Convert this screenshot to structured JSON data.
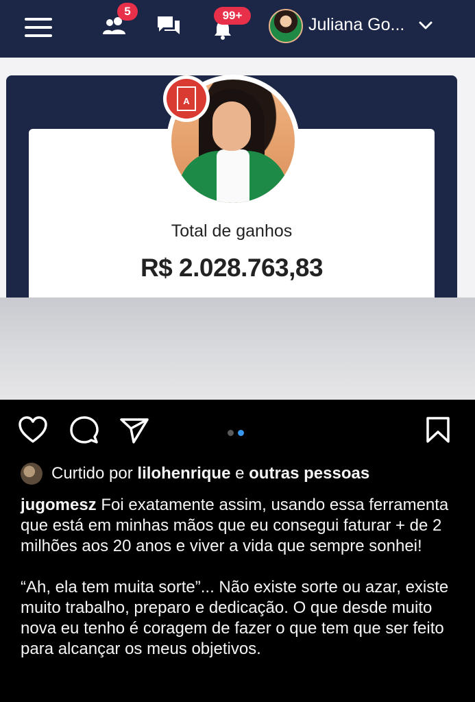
{
  "header": {
    "menu_icon": "hamburger-menu-icon",
    "friends_badge": "5",
    "notifications_badge": "99+",
    "user_name": "Juliana Go...",
    "icons": [
      "friends-icon",
      "chat-icon",
      "bell-icon",
      "chevron-down-icon"
    ]
  },
  "card": {
    "earnings_label": "Total de ganhos",
    "earnings_value": "R$ 2.028.763,83",
    "seal_text": "A"
  },
  "post": {
    "carousel": {
      "count": 2,
      "active": 2
    },
    "likes": {
      "prefix": "Curtido por",
      "user": "lilohenrique",
      "middle": "e",
      "others": "outras pessoas"
    },
    "caption": {
      "username": "jugomesz",
      "paragraph1": "Foi exatamente assim, usando essa ferramenta que está em minhas mãos que eu consegui faturar + de 2 milhões aos 20 anos e viver a vida que sempre sonhei!",
      "paragraph2": "“Ah, ela tem muita sorte”... Não existe sorte ou azar, existe muito trabalho, preparo e dedicação. O que desde muito nova  eu tenho é coragem de fazer o que tem que ser feito para alcançar os meus objetivos."
    }
  },
  "colors": {
    "navbar": "#1c2747",
    "badge": "#e8304b",
    "carousel_active": "#3897f0",
    "background": "#000000"
  }
}
